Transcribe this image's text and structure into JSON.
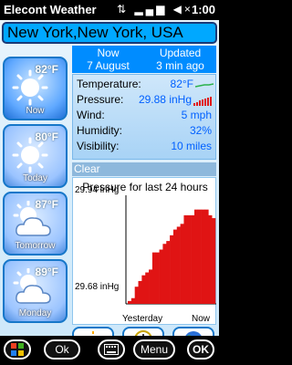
{
  "status_bar": {
    "app_title": "Elecont Weather",
    "status_icons": "⇅ ▂▄▆ ◀×",
    "time": "1:00"
  },
  "location": "New York,New York, USA",
  "forecast_tiles": [
    {
      "label": "Now",
      "temp": "82°F",
      "icon": "sun-icon"
    },
    {
      "label": "Today",
      "temp": "80°F",
      "icon": "sun-icon"
    },
    {
      "label": "Tomorrow",
      "temp": "87°F",
      "icon": "partly-cloudy-icon"
    },
    {
      "label": "Monday",
      "temp": "89°F",
      "icon": "partly-cloudy-icon"
    }
  ],
  "header": {
    "left_top": "Now",
    "left_bottom": "7 August",
    "right_top": "Updated",
    "right_bottom": "3 min ago"
  },
  "conditions": [
    {
      "key": "Temperature:",
      "value": "82°F"
    },
    {
      "key": "Pressure:",
      "value": "29.88 inHg"
    },
    {
      "key": "Wind:",
      "value": "5 mph"
    },
    {
      "key": "Humidity:",
      "value": "32%"
    },
    {
      "key": "Visibility:",
      "value": "10 miles"
    }
  ],
  "condition_text": "Clear",
  "chart_data": {
    "type": "bar",
    "title": "Pressure for last 24 hours",
    "y_ticks": [
      "29.94 inHg",
      "29.68 inHg"
    ],
    "x_labels": [
      "Yesterday",
      "Now"
    ],
    "ylim": [
      29.62,
      30.0
    ],
    "values": [
      29.63,
      29.64,
      29.68,
      29.7,
      29.72,
      29.73,
      29.74,
      29.8,
      29.8,
      29.81,
      29.83,
      29.84,
      29.86,
      29.88,
      29.89,
      29.9,
      29.93,
      29.93,
      29.93,
      29.95,
      29.95,
      29.95,
      29.95,
      29.93,
      29.92
    ]
  },
  "bottom_buttons": [
    {
      "name": "sunrise-button",
      "icon": "sunrise-icon"
    },
    {
      "name": "clock-button",
      "icon": "clock-icon"
    },
    {
      "name": "globe-button",
      "icon": "globe-icon"
    }
  ],
  "taskbar": {
    "ok_label": "Ok",
    "menu_label": "Menu",
    "ok_round_label": "OK"
  }
}
